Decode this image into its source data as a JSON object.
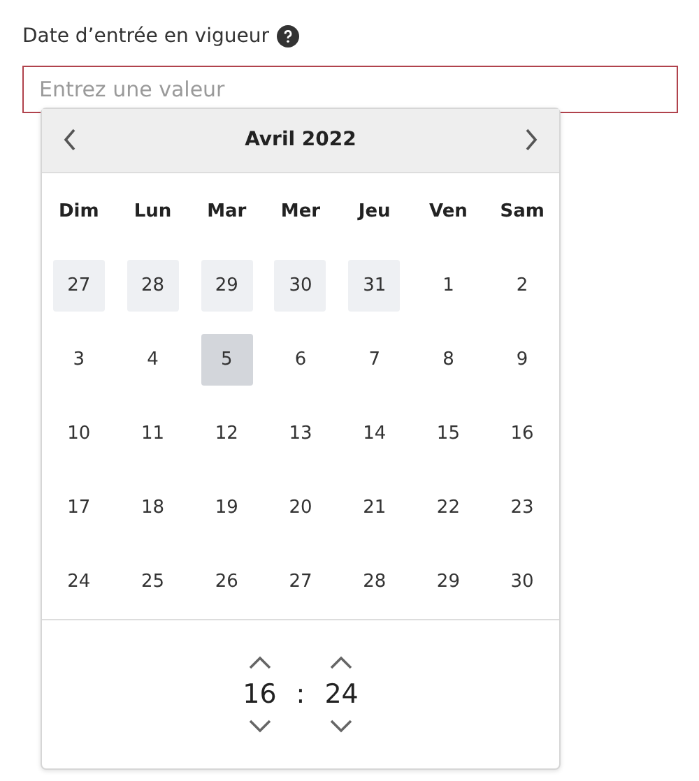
{
  "field": {
    "label": "Date d’entrée en vigueur",
    "placeholder": "Entrez une valeur"
  },
  "calendar": {
    "month": "Avril  2022",
    "weekdays": [
      "Dim",
      "Lun",
      "Mar",
      "Mer",
      "Jeu",
      "Ven",
      "Sam"
    ],
    "weeks": [
      [
        {
          "day": "27",
          "outside": true,
          "selected": false
        },
        {
          "day": "28",
          "outside": true,
          "selected": false
        },
        {
          "day": "29",
          "outside": true,
          "selected": false
        },
        {
          "day": "30",
          "outside": true,
          "selected": false
        },
        {
          "day": "31",
          "outside": true,
          "selected": false
        },
        {
          "day": "1",
          "outside": false,
          "selected": false
        },
        {
          "day": "2",
          "outside": false,
          "selected": false
        }
      ],
      [
        {
          "day": "3",
          "outside": false,
          "selected": false
        },
        {
          "day": "4",
          "outside": false,
          "selected": false
        },
        {
          "day": "5",
          "outside": false,
          "selected": true
        },
        {
          "day": "6",
          "outside": false,
          "selected": false
        },
        {
          "day": "7",
          "outside": false,
          "selected": false
        },
        {
          "day": "8",
          "outside": false,
          "selected": false
        },
        {
          "day": "9",
          "outside": false,
          "selected": false
        }
      ],
      [
        {
          "day": "10",
          "outside": false,
          "selected": false
        },
        {
          "day": "11",
          "outside": false,
          "selected": false
        },
        {
          "day": "12",
          "outside": false,
          "selected": false
        },
        {
          "day": "13",
          "outside": false,
          "selected": false
        },
        {
          "day": "14",
          "outside": false,
          "selected": false
        },
        {
          "day": "15",
          "outside": false,
          "selected": false
        },
        {
          "day": "16",
          "outside": false,
          "selected": false
        }
      ],
      [
        {
          "day": "17",
          "outside": false,
          "selected": false
        },
        {
          "day": "18",
          "outside": false,
          "selected": false
        },
        {
          "day": "19",
          "outside": false,
          "selected": false
        },
        {
          "day": "20",
          "outside": false,
          "selected": false
        },
        {
          "day": "21",
          "outside": false,
          "selected": false
        },
        {
          "day": "22",
          "outside": false,
          "selected": false
        },
        {
          "day": "23",
          "outside": false,
          "selected": false
        }
      ],
      [
        {
          "day": "24",
          "outside": false,
          "selected": false
        },
        {
          "day": "25",
          "outside": false,
          "selected": false
        },
        {
          "day": "26",
          "outside": false,
          "selected": false
        },
        {
          "day": "27",
          "outside": false,
          "selected": false
        },
        {
          "day": "28",
          "outside": false,
          "selected": false
        },
        {
          "day": "29",
          "outside": false,
          "selected": false
        },
        {
          "day": "30",
          "outside": false,
          "selected": false
        }
      ]
    ]
  },
  "time": {
    "hours": "16",
    "separator": ":",
    "minutes": "24"
  }
}
